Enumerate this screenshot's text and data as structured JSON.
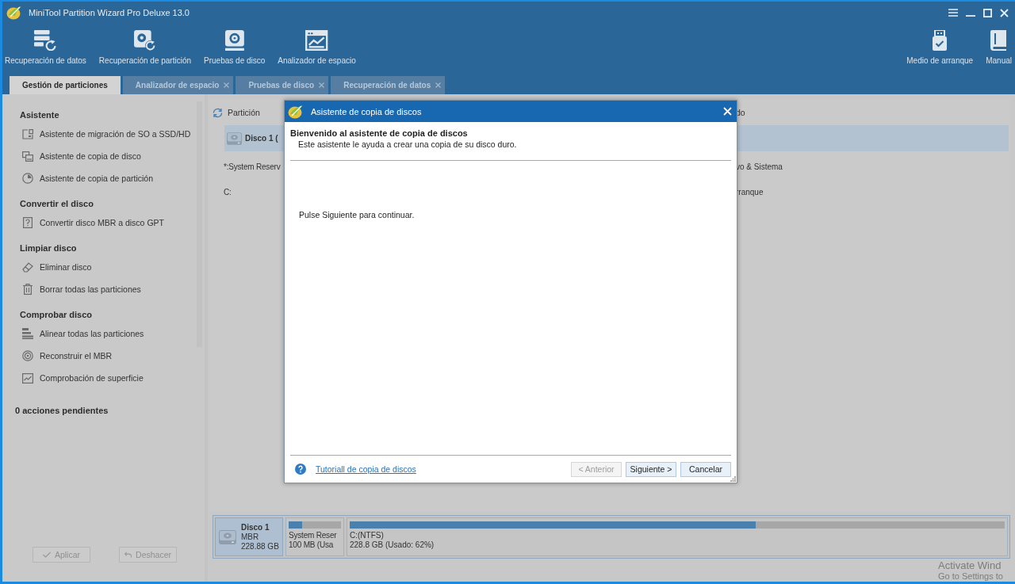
{
  "window": {
    "title": "MiniTool Partition Wizard Pro Deluxe 13.0"
  },
  "toolbar": {
    "left": [
      {
        "label": "Recuperación de datos"
      },
      {
        "label": "Recuperación de partición"
      },
      {
        "label": "Pruebas de disco"
      },
      {
        "label": "Analizador de espacio"
      }
    ],
    "right": [
      {
        "label": "Medio de arranque"
      },
      {
        "label": "Manual"
      }
    ]
  },
  "tabs": [
    {
      "label": "Gestión de particiones",
      "selected": true,
      "closable": false
    },
    {
      "label": "Analizador de espacio",
      "selected": false,
      "closable": true
    },
    {
      "label": "Pruebas de disco",
      "selected": false,
      "closable": true
    },
    {
      "label": "Recuperación de datos",
      "selected": false,
      "closable": true
    }
  ],
  "sidebar": {
    "sections": [
      {
        "title": "Asistente",
        "items": [
          "Asistente de migración de SO a SSD/HD",
          "Asistente de copia de disco",
          "Asistente de copia de partición"
        ]
      },
      {
        "title": "Convertir el disco",
        "items": [
          "Convertir disco MBR a disco GPT"
        ]
      },
      {
        "title": "Limpiar disco",
        "items": [
          "Eliminar disco",
          "Borrar todas las particiones"
        ]
      },
      {
        "title": "Comprobar disco",
        "items": [
          "Alinear todas las particiones",
          "Reconstruir el MBR",
          "Comprobación de superficie"
        ]
      }
    ],
    "pending": "0 acciones pendientes",
    "buttons": [
      {
        "label": "Aplicar",
        "disabled": true
      },
      {
        "label": "Deshacer",
        "disabled": true
      }
    ]
  },
  "partition_table": {
    "columns": [
      "Partición",
      "do"
    ],
    "rows": [
      {
        "kind": "disk",
        "selected": true,
        "column_1": "Disco 1 ("
      },
      {
        "kind": "partition",
        "selected": false,
        "column_1": "*:System Reserv",
        "column_2": "vo & Sistema"
      },
      {
        "kind": "partition",
        "selected": false,
        "column_1": "C:",
        "column_2": "rranque"
      }
    ]
  },
  "dialog": {
    "title": "Asistente de copia de discos",
    "heading": "Bienvenido al asistente de copia de discos",
    "subheading": "Este asistente le ayuda a crear una copia de su disco duro.",
    "body": "Pulse Siguiente para continuar.",
    "help_link": "Tutoriall de copia de discos",
    "buttons": [
      {
        "label": "< Anterior",
        "disabled": true
      },
      {
        "label": "Siguiente >",
        "disabled": false
      },
      {
        "label": "Cancelar",
        "disabled": false
      }
    ]
  },
  "disk_map": {
    "disk": {
      "name": "Disco 1",
      "type": "MBR",
      "size": "228.88 GB",
      "selected": true
    },
    "partitions": [
      {
        "name": "System Reser",
        "detail": "100 MB (Usa",
        "level": 0.25
      },
      {
        "name": "C:(NTFS)",
        "detail": "228.8 GB (Usado: 62%)",
        "level": 0.62
      }
    ]
  },
  "activation_notice": {
    "title": "Activate Wind",
    "subtitle": "Go to Settings to"
  }
}
